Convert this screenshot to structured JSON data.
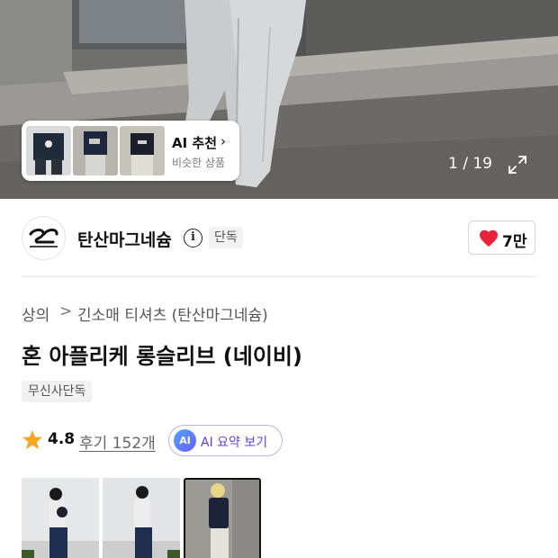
{
  "hero": {
    "counter": "1 / 19"
  },
  "ai_recommend": {
    "title": "AI 추천",
    "chevron": "›",
    "subtitle": "비슷한 상품"
  },
  "brand": {
    "name": "탄산마그네슘",
    "info_icon_glyph": "i",
    "tag": "단독",
    "logo_icon": "brand-logo-icon"
  },
  "like": {
    "count": "7만",
    "heart_color": "#e8233a"
  },
  "breadcrumb": {
    "items": [
      "상의",
      "긴소매 티셔츠 (탄산마그네슘)"
    ],
    "separator": ">"
  },
  "product": {
    "title": "혼 아플리케 롱슬리브 (네이비)",
    "badge": "무신사단독"
  },
  "rating": {
    "score": "4.8",
    "reviews": "후기 152개",
    "star_color": "#f5a623"
  },
  "ai_summary": {
    "badge": "AI",
    "label": "AI 요약 보기",
    "accent": "#5a45e0"
  }
}
